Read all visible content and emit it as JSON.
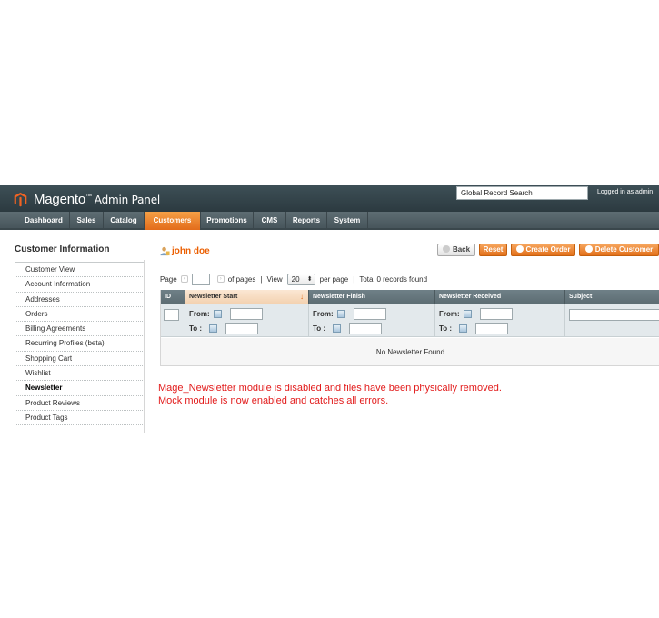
{
  "header": {
    "logo_text": "Magento",
    "logo_sup": "™",
    "logo_panel": "Admin Panel",
    "search_value": "Global Record Search",
    "logged_in": "Logged in as admin"
  },
  "nav": {
    "items": [
      {
        "label": "Dashboard"
      },
      {
        "label": "Sales"
      },
      {
        "label": "Catalog"
      },
      {
        "label": "Customers"
      },
      {
        "label": "Promotions"
      },
      {
        "label": "CMS"
      },
      {
        "label": "Reports"
      },
      {
        "label": "System"
      }
    ],
    "active": "Customers"
  },
  "sidebar": {
    "title": "Customer Information",
    "items": [
      {
        "label": "Customer View"
      },
      {
        "label": "Account Information"
      },
      {
        "label": "Addresses"
      },
      {
        "label": "Orders"
      },
      {
        "label": "Billing Agreements"
      },
      {
        "label": "Recurring Profiles (beta)"
      },
      {
        "label": "Shopping Cart"
      },
      {
        "label": "Wishlist"
      },
      {
        "label": "Newsletter"
      },
      {
        "label": "Product Reviews"
      },
      {
        "label": "Product Tags"
      }
    ],
    "active": "Newsletter"
  },
  "content": {
    "customer_name": "john doe",
    "buttons": {
      "back": "Back",
      "reset": "Reset",
      "create_order": "Create Order",
      "delete_customer": "Delete Customer"
    },
    "pager": {
      "page_label": "Page",
      "of_pages": "of pages",
      "view_label": "View",
      "per_page_value": "20",
      "per_page_label": "per page",
      "records": "Total 0 records found"
    },
    "grid": {
      "columns": [
        "ID",
        "Newsletter Start",
        "Newsletter Finish",
        "Newsletter Received",
        "Subject"
      ],
      "sorted_column": "Newsletter Start",
      "sort_glyph": "↓",
      "from_label": "From:",
      "to_label": "To :",
      "empty_text": "No Newsletter Found"
    },
    "errors": [
      "Mage_Newsletter module is disabled and files have been physically removed.",
      "Mock module is now enabled and catches all errors."
    ]
  },
  "colors": {
    "accent": "#eb5e00",
    "error": "#e21b1b",
    "header_bg": "#2c3a40"
  }
}
